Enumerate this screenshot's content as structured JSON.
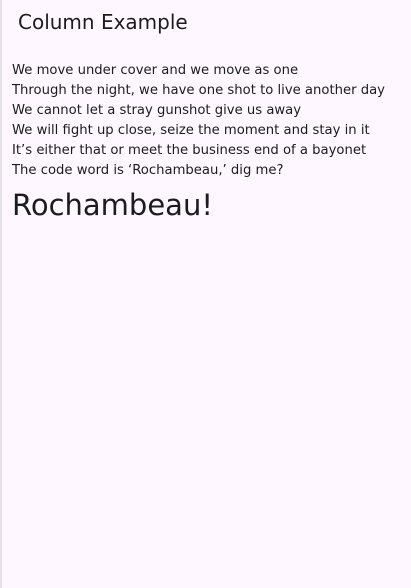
{
  "app_bar": {
    "title": "Column Example"
  },
  "lyrics": [
    "We move under cover and we move as one",
    "Through the night, we have one shot to live another day",
    "We cannot let a stray gunshot give us away",
    "We will fight up close, seize the moment and stay in it",
    "It’s either that or meet the business end of a bayonet",
    "The code word is ‘Rochambeau,’ dig me?"
  ],
  "shout": "Rochambeau!",
  "colors": {
    "background": "#fef7ff",
    "text": "#1c1b1f"
  }
}
